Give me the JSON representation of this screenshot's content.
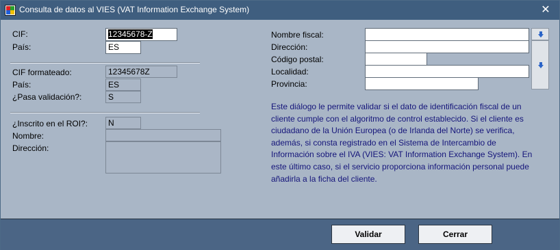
{
  "window": {
    "title": "Consulta de datos al VIES (VAT Information Exchange System)",
    "close_glyph": "✕"
  },
  "left": {
    "cif_label": "CIF:",
    "cif_value": "12345678-Z",
    "pais_label": "País:",
    "pais_value": "ES",
    "cif_formateado_label": "CIF formateado:",
    "cif_formateado_value": "12345678Z",
    "pais2_label": "País:",
    "pais2_value": "ES",
    "validacion_label": "¿Pasa validación?:",
    "validacion_value": "S",
    "roi_label": "¿Inscrito en el ROI?:",
    "roi_value": "N",
    "nombre_label": "Nombre:",
    "nombre_value": "",
    "direccion_label": "Dirección:",
    "direccion_value": ""
  },
  "right": {
    "nombre_fiscal_label": "Nombre fiscal:",
    "nombre_fiscal_value": "",
    "direccion_label": "Dirección:",
    "direccion_value": "",
    "codigo_postal_label": "Código postal:",
    "codigo_postal_value": "",
    "localidad_label": "Localidad:",
    "localidad_value": "",
    "provincia_label": "Provincia:",
    "provincia_value": ""
  },
  "help_text": "Este diálogo le permite validar si el dato de identificación fiscal de un cliente cumple con el algoritmo de control establecido. Si el cliente es ciudadano de la Unión Europea (o de Irlanda del Norte) se verifica, además, si consta registrado en el Sistema de Intercambio de Información sobre el IVA (VIES: VAT Information Exchange System). En este último caso, si el servicio proporciona información personal puede añadirla a la ficha del cliente.",
  "buttons": {
    "validar": "Validar",
    "cerrar": "Cerrar"
  },
  "icons": {
    "app": "app-logo-icon",
    "copy_down": "arrow-down-icon"
  },
  "colors": {
    "titlebar": "#3f5e7f",
    "body": "#a9b6c6",
    "footer": "#4b6585",
    "help_text": "#14147a",
    "arrow": "#2b64c8"
  }
}
